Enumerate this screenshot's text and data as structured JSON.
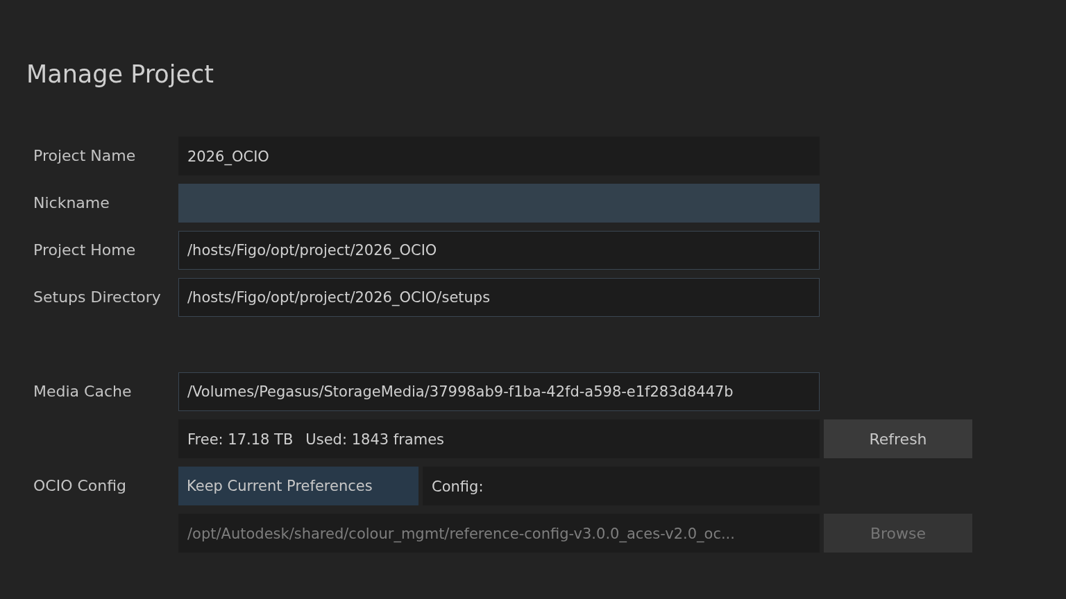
{
  "title": "Manage Project",
  "project_fields": [
    {
      "label": "Project Name",
      "value": "2026_OCIO",
      "kind": "plain",
      "focused": false
    },
    {
      "label": "Nickname",
      "kind": "plain",
      "focused": true
    },
    {
      "label": "Project Home",
      "value": "/hosts/Figo/opt/project/2026_OCIO",
      "kind": "bordered",
      "focused": false
    },
    {
      "label": "Setups Directory",
      "value": "/hosts/Figo/opt/project/2026_OCIO/setups",
      "kind": "bordered",
      "focused": false
    }
  ],
  "media_cache": {
    "label": "Media Cache",
    "value": "/Volumes/Pegasus/StorageMedia/37998ab9-f1ba-42fd-a598-e1f283d8447b",
    "free": "Free: 17.18 TB",
    "used": "Used: 1843 frames",
    "refresh_button": "Refresh"
  },
  "ocio_config": {
    "label": "OCIO Config",
    "mode_button": {
      "label": "Keep Current Preferences",
      "on": true
    },
    "config_label": "Config:",
    "path": {
      "value": "/opt/Autodesk/shared/colour_mgmt/reference-config-v3.0.0_aces-v2.0_oc...",
      "disabled": true
    },
    "browse_button": {
      "label": "Browse",
      "disabled": true
    }
  }
}
